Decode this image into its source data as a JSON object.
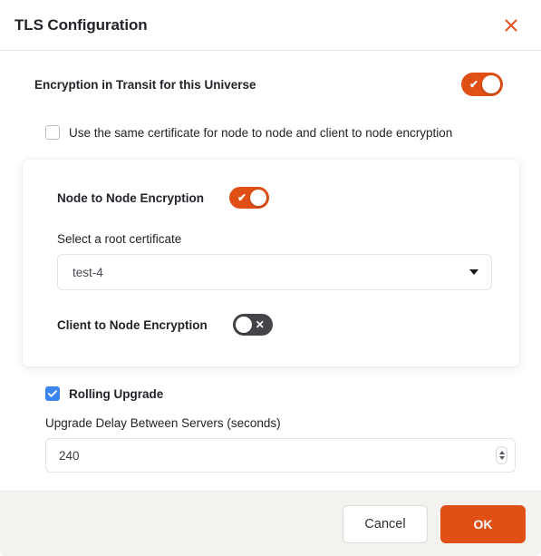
{
  "header": {
    "title": "TLS Configuration",
    "close_icon": "close-icon"
  },
  "body": {
    "encryption_in_transit": {
      "label": "Encryption in Transit for this Universe",
      "toggle_state": "on",
      "toggle_glyph": "✔"
    },
    "same_certificate": {
      "label": "Use the same certificate for node to node and client to node encryption",
      "checked": false
    },
    "card": {
      "node_to_node": {
        "label": "Node to Node Encryption",
        "toggle_state": "on",
        "toggle_glyph": "✔"
      },
      "root_certificate": {
        "label": "Select a root certificate",
        "value": "test-4",
        "caret_icon": "chevron-down-icon"
      },
      "client_to_node": {
        "label": "Client to Node Encryption",
        "toggle_state": "off",
        "toggle_glyph": "✕"
      }
    },
    "rolling_upgrade": {
      "label": "Rolling Upgrade",
      "checked": true
    },
    "upgrade_delay": {
      "label": "Upgrade Delay Between Servers (seconds)",
      "value": "240",
      "spinner_icon": "number-spinner-icon"
    }
  },
  "footer": {
    "cancel_label": "Cancel",
    "ok_label": "OK"
  },
  "colors": {
    "accent_orange": "#e04f16",
    "toggle_off_gray": "#444449",
    "checkbox_blue": "#3c85f0",
    "footer_bg": "#f3f2ee"
  }
}
